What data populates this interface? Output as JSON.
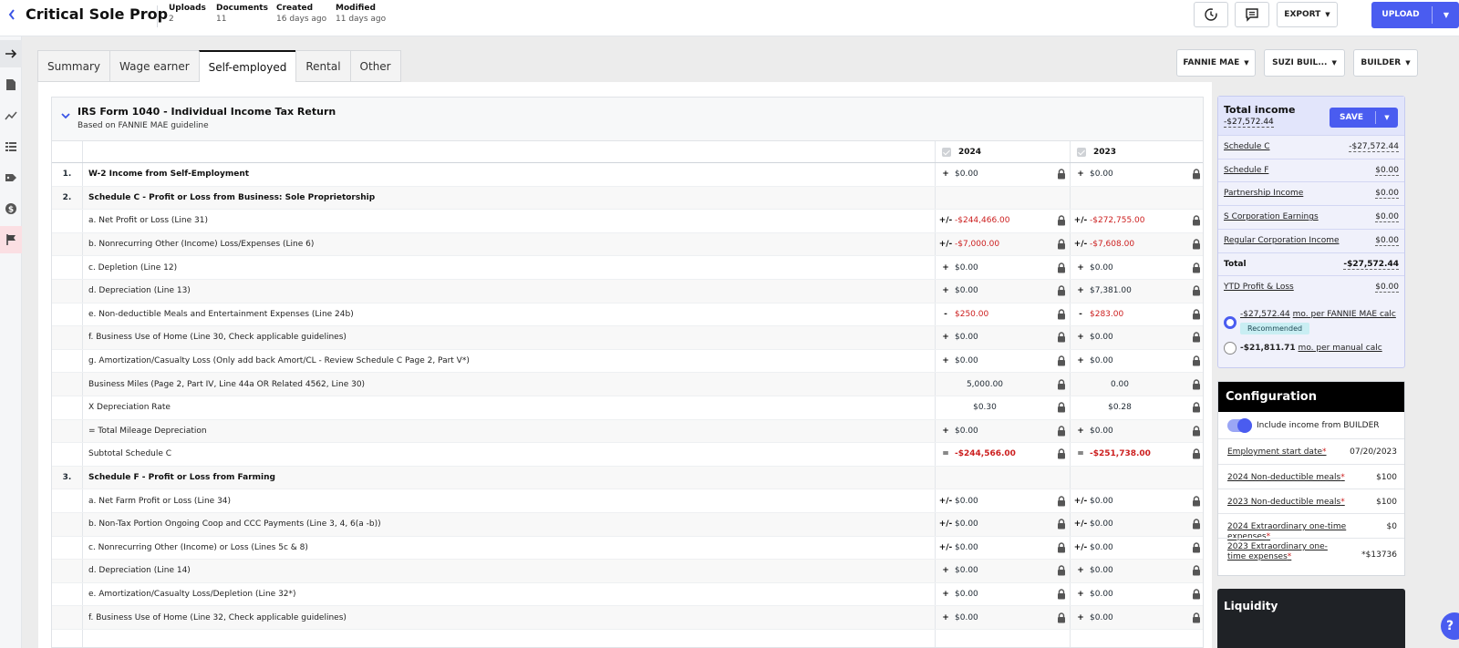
{
  "header": {
    "back_icon": "chevron-left-icon",
    "title": "Critical Sole Prop",
    "meta": [
      {
        "label": "Uploads",
        "value": "2"
      },
      {
        "label": "Documents",
        "value": "11"
      },
      {
        "label": "Created",
        "value": "16 days ago"
      },
      {
        "label": "Modified",
        "value": "11 days ago"
      }
    ],
    "history_icon": "history-icon",
    "comment_icon": "comment-icon",
    "export_label": "EXPORT",
    "upload_label": "UPLOAD"
  },
  "rail": {
    "items": [
      "arrow-right-icon",
      "document-icon",
      "chart-line-icon",
      "list-icon",
      "tag-icon",
      "dollar-icon",
      "flag-icon"
    ]
  },
  "tabs": [
    "Summary",
    "Wage earner",
    "Self-employed",
    "Rental",
    "Other"
  ],
  "active_tab": "Self-employed",
  "dropdowns": {
    "guideline": "FANNIE MAE",
    "borrower": "SUZI BUIL...",
    "role": "BUILDER"
  },
  "form": {
    "title": "IRS Form 1040 - Individual Income Tax Return",
    "subtitle": "Based on FANNIE MAE guideline",
    "years": [
      "2024",
      "2023"
    ],
    "rows": [
      {
        "num": "1.",
        "desc": "W-2 Income from Self-Employment",
        "bold": true,
        "y1": {
          "op": "+",
          "val": "$0.00"
        },
        "y2": {
          "op": "+",
          "val": "$0.00"
        }
      },
      {
        "num": "2.",
        "desc": "Schedule C - Profit or Loss from Business: Sole Proprietorship",
        "bold": true,
        "section": true
      },
      {
        "num": "",
        "desc": "a. Net Profit or Loss (Line 31)",
        "y1": {
          "op": "+/-",
          "val": "-$244,466.00",
          "neg": true
        },
        "y2": {
          "op": "+/-",
          "val": "-$272,755.00",
          "neg": true
        }
      },
      {
        "num": "",
        "desc": "b. Nonrecurring Other (Income) Loss/Expenses (Line 6)",
        "y1": {
          "op": "+/-",
          "val": "-$7,000.00",
          "neg": true
        },
        "y2": {
          "op": "+/-",
          "val": "-$7,608.00",
          "neg": true
        }
      },
      {
        "num": "",
        "desc": "c. Depletion (Line 12)",
        "y1": {
          "op": "+",
          "val": "$0.00"
        },
        "y2": {
          "op": "+",
          "val": "$0.00"
        }
      },
      {
        "num": "",
        "desc": "d. Depreciation (Line 13)",
        "y1": {
          "op": "+",
          "val": "$0.00"
        },
        "y2": {
          "op": "+",
          "val": "$7,381.00"
        }
      },
      {
        "num": "",
        "desc": "e. Non-deductible Meals and Entertainment Expenses (Line 24b)",
        "y1": {
          "op": "-",
          "val": "$250.00",
          "neg": true,
          "opneg": true
        },
        "y2": {
          "op": "-",
          "val": "$283.00",
          "neg": true
        }
      },
      {
        "num": "",
        "desc": "f. Business Use of Home (Line 30, Check applicable guidelines)",
        "y1": {
          "op": "+",
          "val": "$0.00"
        },
        "y2": {
          "op": "+",
          "val": "$0.00"
        }
      },
      {
        "num": "",
        "desc": "g. Amortization/Casualty Loss (Only add back Amort/CL - Review Schedule C Page 2, Part V*)",
        "y1": {
          "op": "+",
          "val": "$0.00"
        },
        "y2": {
          "op": "+",
          "val": "$0.00"
        }
      },
      {
        "num": "",
        "desc": "Business Miles (Page 2, Part IV, Line 44a OR Related 4562, Line 30)",
        "y1": {
          "op": "",
          "val": "5,000.00",
          "center": true
        },
        "y2": {
          "op": "",
          "val": "0.00",
          "center": true
        }
      },
      {
        "num": "",
        "desc": "X Depreciation Rate",
        "y1": {
          "op": "",
          "val": "$0.30",
          "center": true
        },
        "y2": {
          "op": "",
          "val": "$0.28",
          "center": true
        }
      },
      {
        "num": "",
        "desc": "= Total Mileage Depreciation",
        "y1": {
          "op": "+",
          "val": "$0.00"
        },
        "y2": {
          "op": "+",
          "val": "$0.00"
        }
      },
      {
        "num": "",
        "desc": "Subtotal Schedule C",
        "y1": {
          "op": "=",
          "val": "-$244,566.00",
          "neg": true,
          "boldval": true
        },
        "y2": {
          "op": "=",
          "val": "-$251,738.00",
          "neg": true,
          "boldval": true
        }
      },
      {
        "num": "3.",
        "desc": "Schedule F - Profit or Loss from Farming",
        "bold": true,
        "section": true
      },
      {
        "num": "",
        "desc": "a. Net Farm Profit or Loss (Line 34)",
        "y1": {
          "op": "+/-",
          "val": "$0.00"
        },
        "y2": {
          "op": "+/-",
          "val": "$0.00"
        }
      },
      {
        "num": "",
        "desc": "b. Non-Tax Portion Ongoing Coop and CCC Payments (Line 3, 4, 6(a -b))",
        "y1": {
          "op": "+/-",
          "val": "$0.00"
        },
        "y2": {
          "op": "+/-",
          "val": "$0.00"
        }
      },
      {
        "num": "",
        "desc": "c. Nonrecurring Other (Income) or Loss (Lines 5c & 8)",
        "y1": {
          "op": "+/-",
          "val": "$0.00"
        },
        "y2": {
          "op": "+/-",
          "val": "$0.00"
        }
      },
      {
        "num": "",
        "desc": "d. Depreciation (Line 14)",
        "y1": {
          "op": "+",
          "val": "$0.00"
        },
        "y2": {
          "op": "+",
          "val": "$0.00"
        }
      },
      {
        "num": "",
        "desc": "e. Amortization/Casualty Loss/Depletion (Line 32*)",
        "y1": {
          "op": "+",
          "val": "$0.00"
        },
        "y2": {
          "op": "+",
          "val": "$0.00"
        }
      },
      {
        "num": "",
        "desc": "f. Business Use of Home (Line 32, Check applicable guidelines)",
        "y1": {
          "op": "+",
          "val": "$0.00"
        },
        "y2": {
          "op": "+",
          "val": "$0.00"
        }
      },
      {
        "num": "",
        "desc": "",
        "y1": {
          "op": "",
          "val": ""
        },
        "y2": {
          "op": "",
          "val": ""
        }
      }
    ]
  },
  "total_income": {
    "title": "Total income",
    "value": "-$27,572.44",
    "save_label": "SAVE",
    "rows": [
      {
        "label": "Schedule C",
        "value": "-$27,572.44"
      },
      {
        "label": "Schedule F",
        "value": "$0.00"
      },
      {
        "label": "Partnership Income",
        "value": "$0.00"
      },
      {
        "label": "S Corporation Earnings",
        "value": "$0.00"
      },
      {
        "label": "Regular Corporation Income",
        "value": "$0.00"
      },
      {
        "label": "Total",
        "value": "-$27,572.44",
        "bold": true
      },
      {
        "label": "YTD Profit & Loss",
        "value": "$0.00"
      }
    ],
    "option1_value": "-$27,572.44",
    "option1_text": "mo. per FANNIE MAE calc",
    "recommended": "Recommended",
    "option2_value": "-$21,811.71",
    "option2_text": "mo. per manual calc"
  },
  "configuration": {
    "title": "Configuration",
    "toggle_label": "Include income from BUILDER",
    "rows": [
      {
        "label": "Employment start date",
        "value": "07/20/2023"
      },
      {
        "label": "2024 Non-deductible meals",
        "value": "$100"
      },
      {
        "label": "2023 Non-deductible meals",
        "value": "$100"
      },
      {
        "label": "2024 Extraordinary one-time expenses",
        "value": "$0"
      },
      {
        "label": "2023 Extraordinary one-time expenses",
        "value": "*$13736"
      }
    ],
    "required_mark": "*"
  },
  "liquidity": {
    "title": "Liquidity"
  },
  "help_label": "?"
}
